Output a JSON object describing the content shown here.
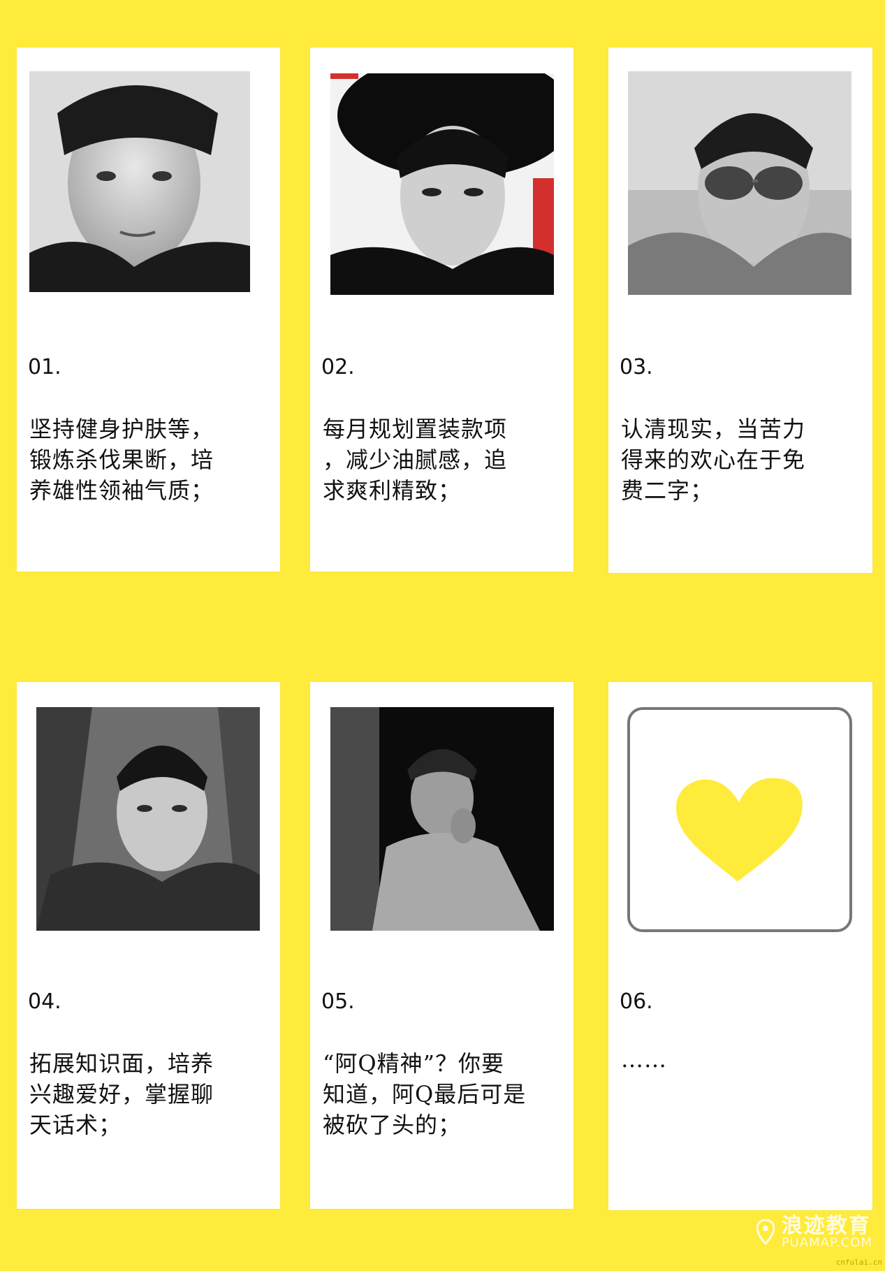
{
  "colors": {
    "background": "#FFEB3B",
    "card": "#FFFFFF",
    "heart": "#FFEB3B",
    "heart_border": "#777777"
  },
  "cards": [
    {
      "number": "01.",
      "text": "坚持健身护肤等，\n锻炼杀伐果断，培\n养雄性领袖气质；",
      "image": "portrait-photo-bw"
    },
    {
      "number": "02.",
      "text": "每月规划置装款项\n，减少油腻感，追\n求爽利精致；",
      "image": "portrait-photo-bw-hat"
    },
    {
      "number": "03.",
      "text": "认清现实，当苦力\n得来的欢心在于免\n费二字；",
      "image": "portrait-photo-sunglasses"
    },
    {
      "number": "04.",
      "text": "拓展知识面，培养\n兴趣爱好，掌握聊\n天话术；",
      "image": "portrait-photo-earphones"
    },
    {
      "number": "05.",
      "text": "“阿Q精神”？你要\n知道，阿Q最后可是\n被砍了头的；",
      "image": "portrait-photo-old-man"
    },
    {
      "number": "06.",
      "text": "……",
      "image": "heart-icon"
    }
  ],
  "watermark": {
    "main": "浪迹教育",
    "sub": "PUAMAP.COM",
    "small": "cnfulai.cn"
  }
}
